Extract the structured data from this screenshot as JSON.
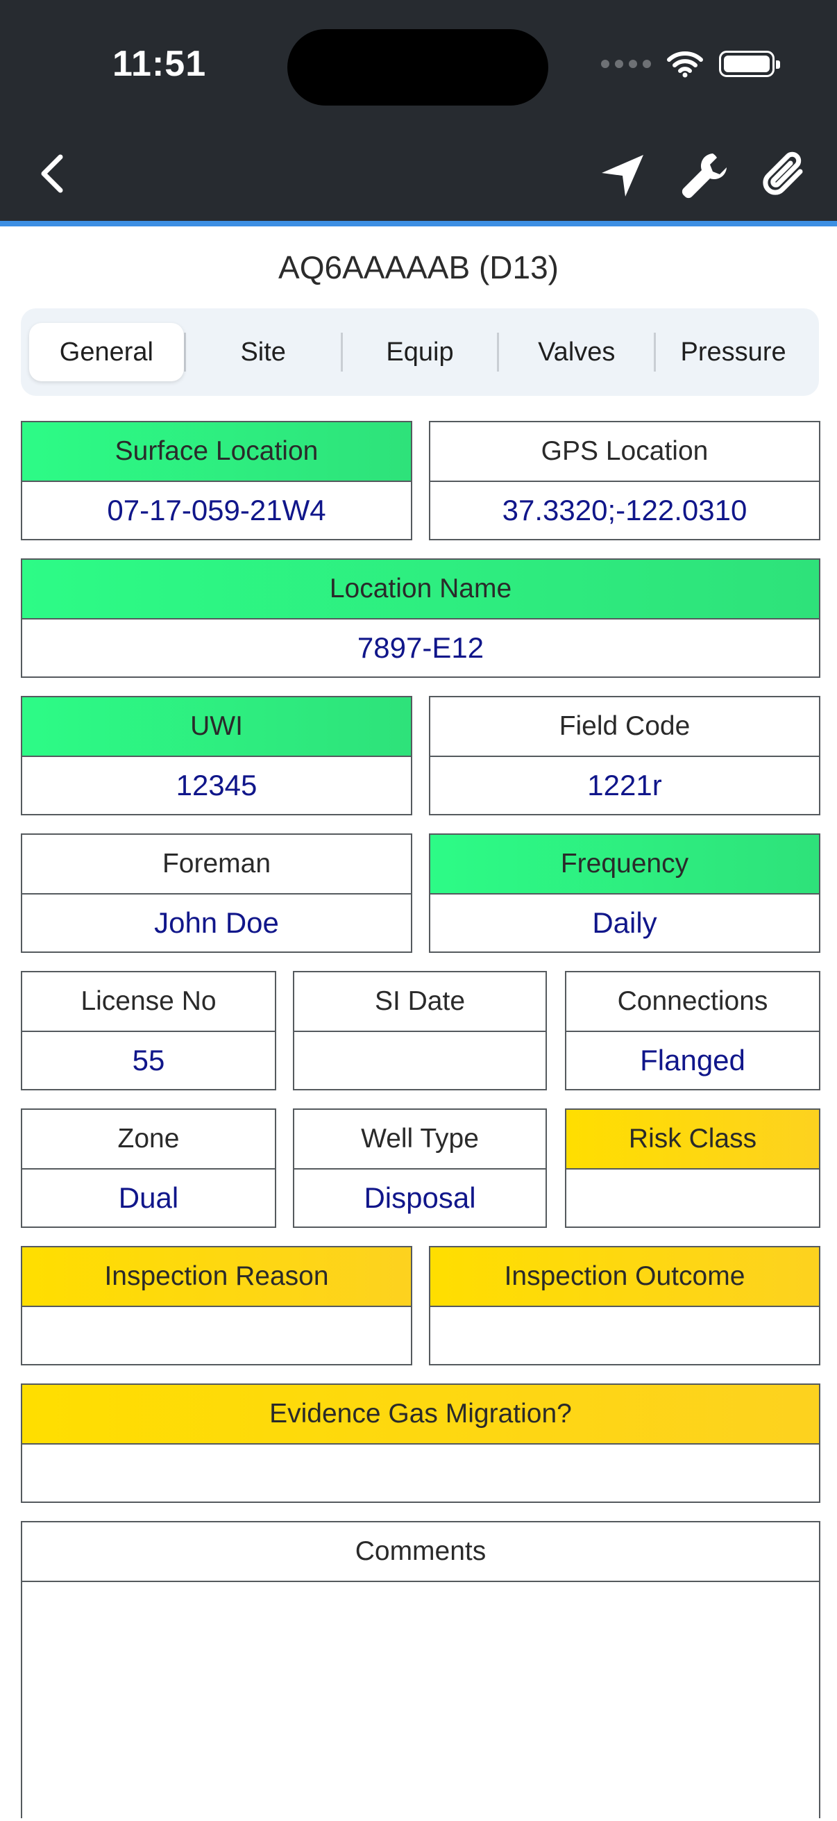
{
  "status_bar": {
    "time": "11:51"
  },
  "nav": {
    "back_icon": "chevron-left-icon",
    "actions": [
      {
        "name": "location-arrow-icon"
      },
      {
        "name": "wrench-icon"
      },
      {
        "name": "paperclip-icon"
      }
    ]
  },
  "title": "AQ6AAAAAB (D13)",
  "tabs": [
    "General",
    "Site",
    "Equip",
    "Valves",
    "Pressure"
  ],
  "active_tab": "General",
  "colors": {
    "required_green": "#2dfb86",
    "warning_yellow": "#ffde00",
    "value_text": "#10168a",
    "accent_blue": "#3d8fe3"
  },
  "fields": {
    "surface_location": {
      "label": "Surface Location",
      "value": "07-17-059-21W4"
    },
    "gps_location": {
      "label": "GPS Location",
      "value": "37.3320;-122.0310"
    },
    "location_name": {
      "label": "Location Name",
      "value": "7897-E12"
    },
    "uwi": {
      "label": "UWI",
      "value": "12345"
    },
    "field_code": {
      "label": "Field Code",
      "value": "1221r"
    },
    "foreman": {
      "label": "Foreman",
      "value": "John Doe"
    },
    "frequency": {
      "label": "Frequency",
      "value": "Daily"
    },
    "license_no": {
      "label": "License No",
      "value": "55"
    },
    "si_date": {
      "label": "SI Date",
      "value": ""
    },
    "connections": {
      "label": "Connections",
      "value": "Flanged"
    },
    "zone": {
      "label": "Zone",
      "value": "Dual"
    },
    "well_type": {
      "label": "Well Type",
      "value": "Disposal"
    },
    "risk_class": {
      "label": "Risk Class",
      "value": ""
    },
    "inspection_reason": {
      "label": "Inspection Reason",
      "value": ""
    },
    "inspection_outcome": {
      "label": "Inspection Outcome",
      "value": ""
    },
    "evidence_gas_migration": {
      "label": "Evidence Gas Migration?",
      "value": ""
    },
    "comments": {
      "label": "Comments",
      "value": ""
    }
  }
}
